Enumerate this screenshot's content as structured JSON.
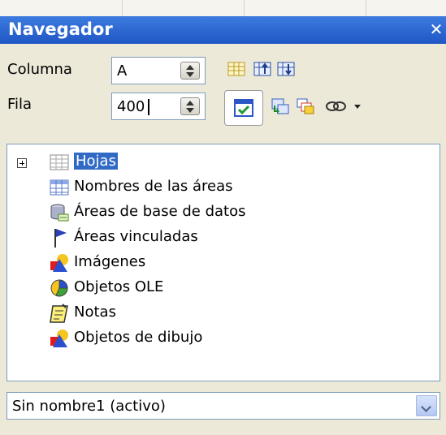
{
  "window": {
    "title": "Navegador"
  },
  "column": {
    "label": "Columna",
    "value": "A"
  },
  "row": {
    "label": "Fila",
    "value": "400"
  },
  "toolbar": {
    "icons": [
      "data-range-icon",
      "start-icon",
      "end-icon",
      "contents-toggle-icon",
      "drag-mode-icon",
      "scenarios-icon",
      "link-icon",
      "dropdown-arrow-icon"
    ]
  },
  "tree": {
    "items": [
      {
        "label": "Hojas",
        "icon": "sheets-icon",
        "selected": true,
        "expandable": true
      },
      {
        "label": "Nombres de las áreas",
        "icon": "range-names-icon"
      },
      {
        "label": "Áreas de base de datos",
        "icon": "database-ranges-icon"
      },
      {
        "label": "Áreas vinculadas",
        "icon": "linked-areas-icon"
      },
      {
        "label": "Imágenes",
        "icon": "images-icon"
      },
      {
        "label": "Objetos OLE",
        "icon": "ole-objects-icon"
      },
      {
        "label": "Notas",
        "icon": "notes-icon"
      },
      {
        "label": "Objetos de dibujo",
        "icon": "drawing-objects-icon"
      }
    ]
  },
  "document_select": {
    "value": "Sin nombre1 (activo)"
  }
}
